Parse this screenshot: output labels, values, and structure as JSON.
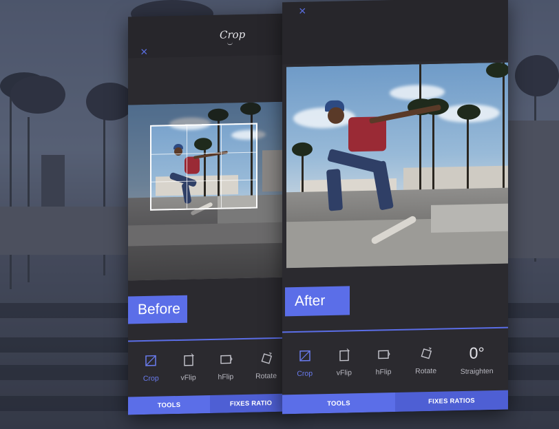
{
  "colors": {
    "accent": "#5b6ee8",
    "panel": "#2b2a2f",
    "text_muted": "#b8b8c0"
  },
  "left_panel": {
    "close_icon": "×",
    "title": "Crop",
    "tag": "Before",
    "tools": [
      {
        "icon": "crop-icon",
        "label": "Crop",
        "active": true
      },
      {
        "icon": "vflip-icon",
        "label": "vFlip"
      },
      {
        "icon": "hflip-icon",
        "label": "hFlip"
      },
      {
        "icon": "rotate-icon",
        "label": "Rotate"
      }
    ],
    "tabs": [
      "TOOLS",
      "FIXES RATIO"
    ]
  },
  "right_panel": {
    "close_icon": "×",
    "tag": "After",
    "tools": [
      {
        "icon": "crop-icon",
        "label": "Crop",
        "active": true
      },
      {
        "icon": "vflip-icon",
        "label": "vFlip"
      },
      {
        "icon": "hflip-icon",
        "label": "hFlip"
      },
      {
        "icon": "rotate-icon",
        "label": "Rotate"
      },
      {
        "icon": "straighten-value",
        "value": "0°",
        "label": "Straighten"
      }
    ],
    "tabs": [
      "TOOLS",
      "FIXES RATIOS"
    ]
  }
}
